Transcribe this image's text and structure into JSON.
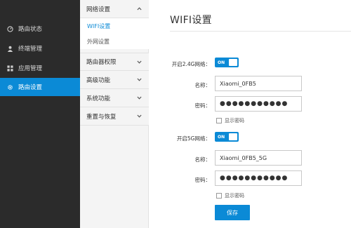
{
  "sidebar": {
    "items": [
      {
        "label": "路由状态",
        "icon": "gauge-icon"
      },
      {
        "label": "终端管理",
        "icon": "user-icon"
      },
      {
        "label": "应用管理",
        "icon": "grid-icon"
      },
      {
        "label": "路由设置",
        "icon": "gear-icon"
      }
    ]
  },
  "submenu": {
    "network_label": "网络设置",
    "wifi_label": "WIFI设置",
    "wan_label": "外网设置",
    "permissions_label": "路由器权限",
    "advanced_label": "高级功能",
    "system_label": "系统功能",
    "reset_label": "重置与恢复"
  },
  "main": {
    "title": "WIFI设置",
    "band24": {
      "toggle_label": "开启2.4G网络：",
      "toggle_value": "ON",
      "name_label": "名称：",
      "name_value": "Xiaomi_0FB5",
      "password_label": "密码：",
      "password_value": "●●●●●●●●●●●",
      "show_password_label": "显示密码"
    },
    "band5": {
      "toggle_label": "开启5G网络：",
      "toggle_value": "ON",
      "name_label": "名称：",
      "name_value": "Xiaomi_0FB5_5G",
      "password_label": "密码：",
      "password_value": "●●●●●●●●●●●",
      "show_password_label": "显示密码"
    },
    "save_label": "保存"
  },
  "colors": {
    "accent": "#0b8ad6",
    "sidebar_bg": "#2b2b2b",
    "submenu_bg": "#f4f4f4"
  }
}
